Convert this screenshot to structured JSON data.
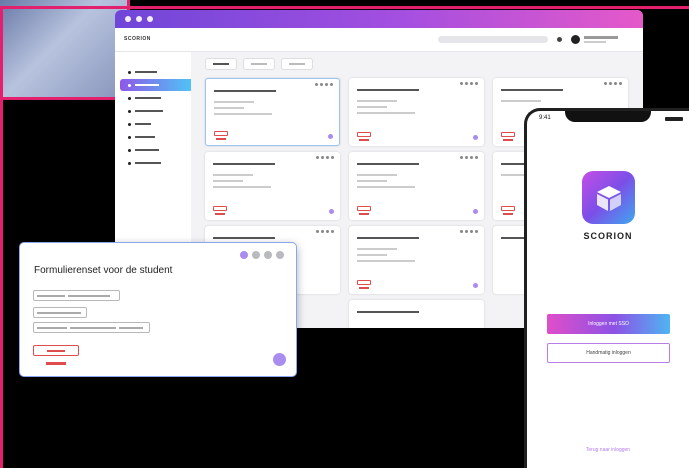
{
  "desktop": {
    "brand": "SCORION",
    "sidebar_items": 9,
    "active_sidebar_index": 1,
    "tabs": 3
  },
  "modal": {
    "title": "Formulierenset voor de student"
  },
  "phone": {
    "time": "9:41",
    "app_name": "SCORION",
    "primary_button": "Inloggen met SSO",
    "secondary_button": "Handmatig inloggen",
    "footer_link": "Terug naar inloggen"
  },
  "colors": {
    "frame": "#e3206e",
    "accent_purple": "#a98cf0",
    "brand_gradient_start": "#6f46d8",
    "brand_gradient_end": "#e559c9",
    "alert_red": "#e04b4b"
  },
  "icons": [
    "cube-logo-icon",
    "bell-icon",
    "avatar",
    "more-dots-icon",
    "search-bar"
  ]
}
